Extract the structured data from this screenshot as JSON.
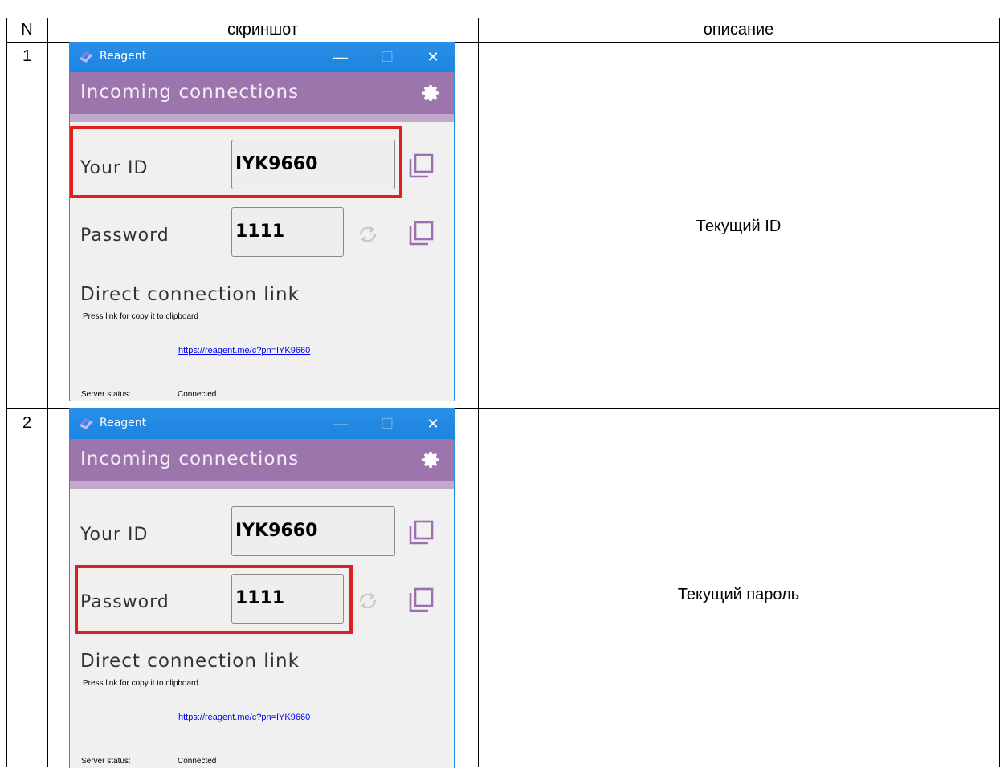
{
  "table": {
    "headers": {
      "n": "N",
      "screenshot": "скриншот",
      "description": "описание"
    },
    "rows": [
      {
        "n": "1",
        "description": "Текущий ID",
        "highlight": "your-id"
      },
      {
        "n": "2",
        "description": "Текущий пароль",
        "highlight": "password"
      }
    ]
  },
  "app": {
    "window_title": "Reagent",
    "header_title": "Incoming connections",
    "your_id_label": "Your ID",
    "your_id_value": "IYK9660",
    "password_label": "Password",
    "password_value": "1111",
    "direct_link_title": "Direct connection link",
    "direct_link_hint": "Press link for copy it to clipboard",
    "direct_link_url": "https://reagent.me/c?pn=IYK9660",
    "server_status_label": "Server status:",
    "server_status_value": "Connected",
    "icons": [
      "reagent-logo-icon",
      "minimize-icon",
      "maximize-icon",
      "close-icon",
      "gear-icon",
      "copy-icon",
      "refresh-icon"
    ],
    "colors": {
      "titlebar": "#1e88e5",
      "header": "#9b75ab",
      "icon_purple": "#9b6fb0",
      "highlight_red": "#e02020",
      "link": "#0000ee"
    }
  }
}
